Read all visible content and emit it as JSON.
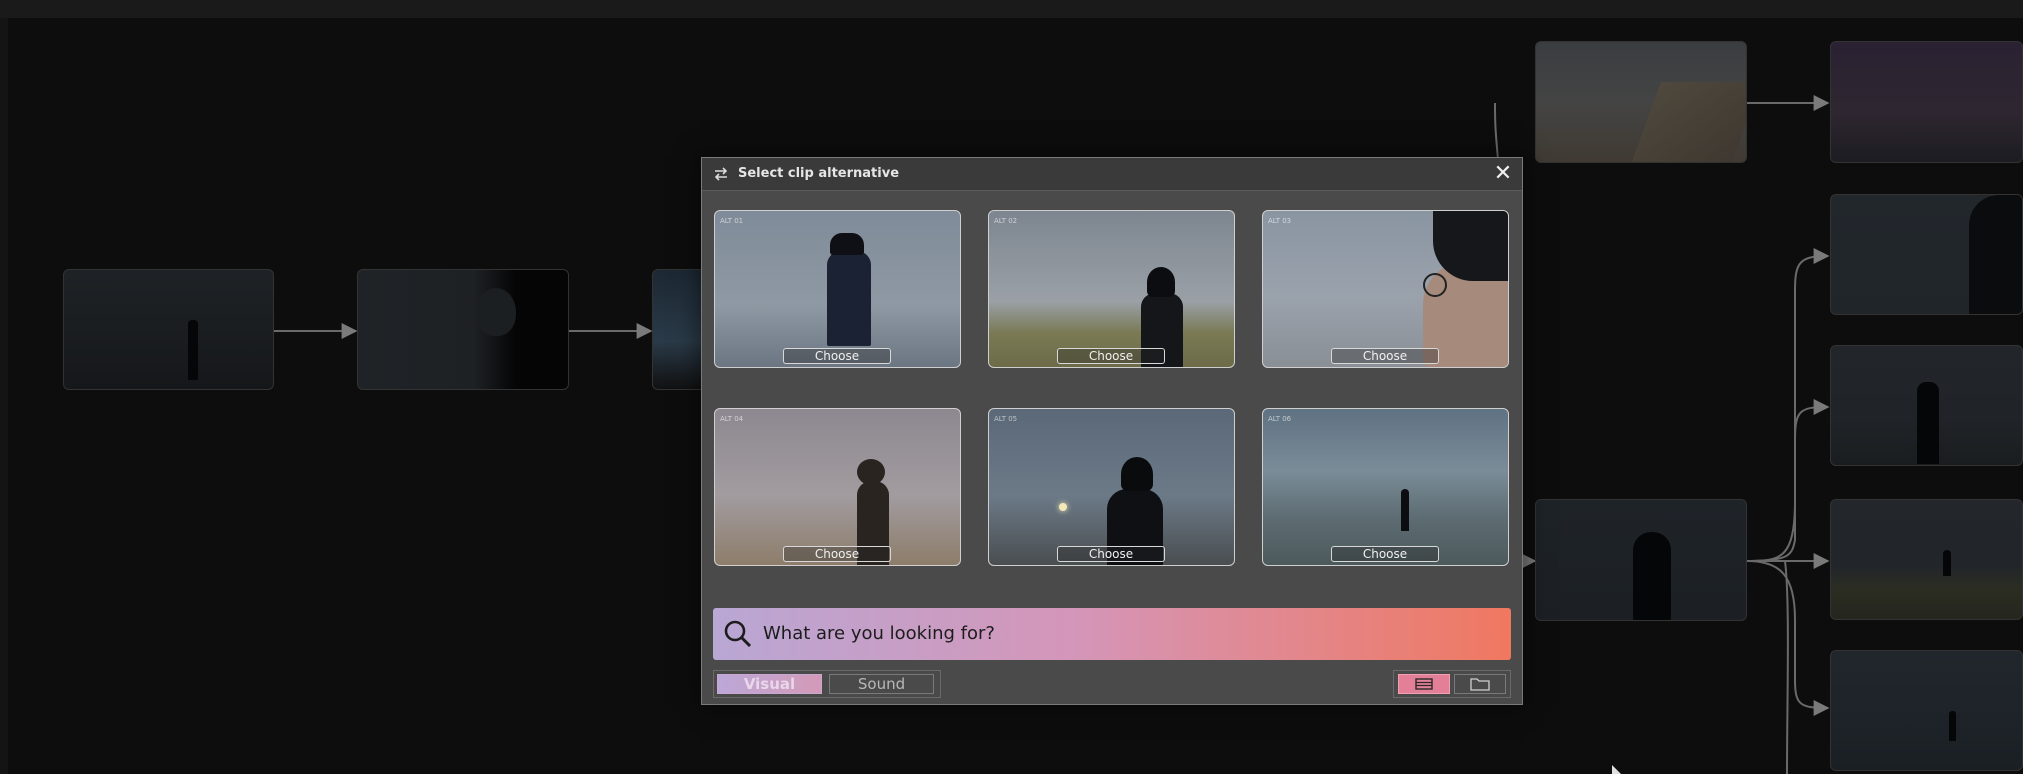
{
  "modal": {
    "title": "Select clip alternative",
    "close_icon": "close-icon",
    "swap_icon": "swap-icon",
    "clips": [
      {
        "choose_label": "Choose",
        "tag": "ALT 01"
      },
      {
        "choose_label": "Choose",
        "tag": "ALT 02"
      },
      {
        "choose_label": "Choose",
        "tag": "ALT 03"
      },
      {
        "choose_label": "Choose",
        "tag": "ALT 04"
      },
      {
        "choose_label": "Choose",
        "tag": "ALT 05"
      },
      {
        "choose_label": "Choose",
        "tag": "ALT 06"
      }
    ],
    "search": {
      "placeholder": "What are you looking for?",
      "icon": "search-icon"
    },
    "tabs": {
      "visual": "Visual",
      "sound": "Sound",
      "active": "Visual"
    },
    "view_buttons": [
      {
        "icon": "list-view-icon",
        "active": true
      },
      {
        "icon": "folder-icon",
        "active": false
      }
    ]
  },
  "colors": {
    "background": "#0d0d0d",
    "modal_bg": "#4a4a4a",
    "search_gradient": [
      "#b9a7d4",
      "#d496b9",
      "#f07860"
    ],
    "active_view": "#e47f98"
  }
}
